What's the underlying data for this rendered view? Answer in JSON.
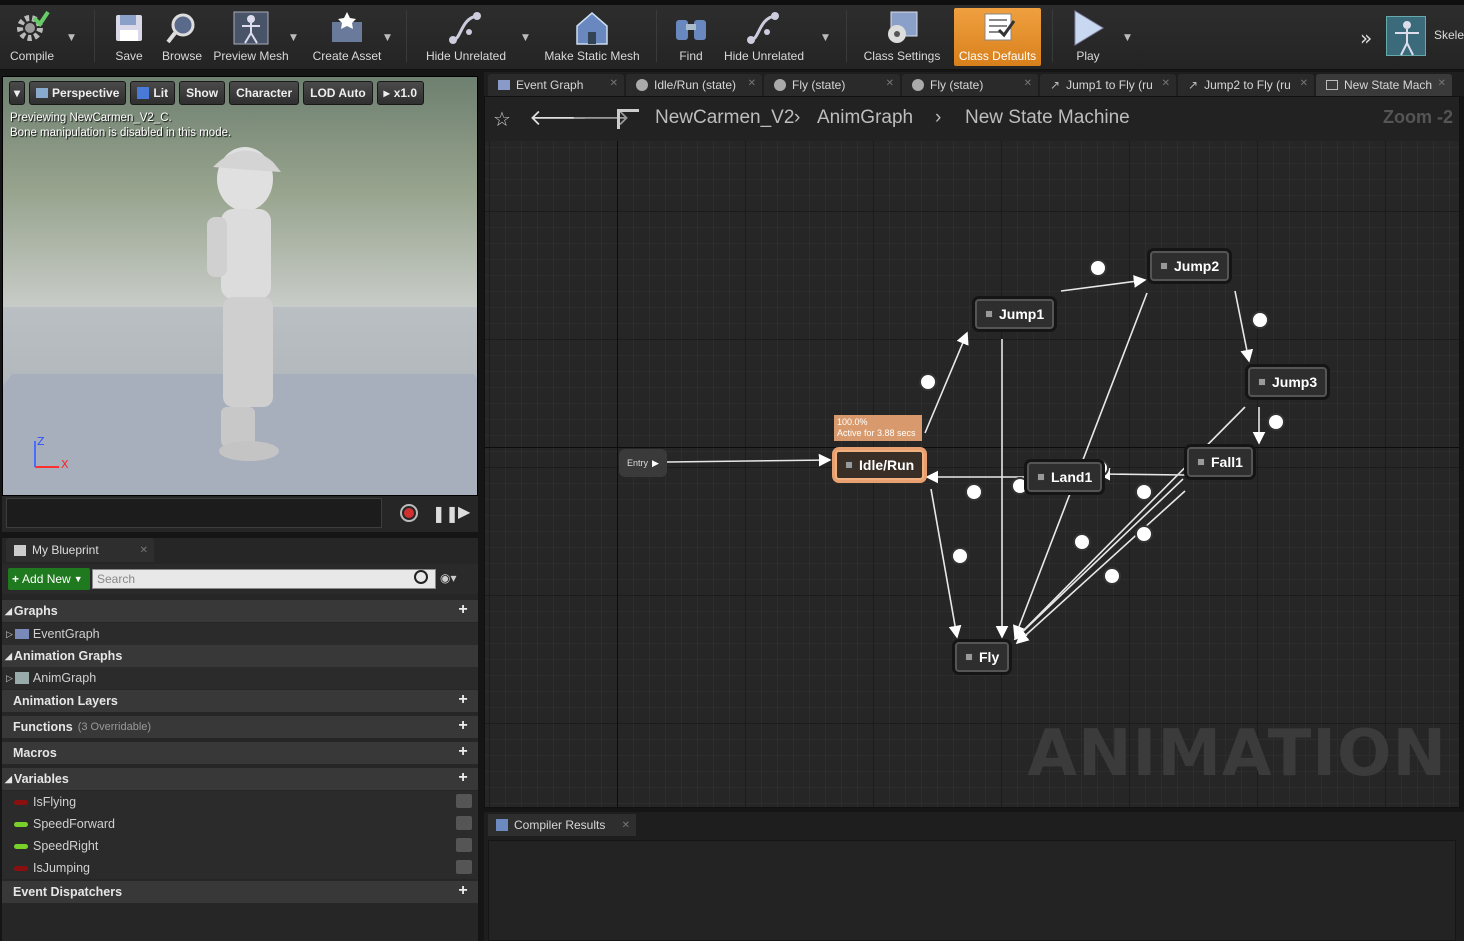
{
  "toolbar": {
    "compile": "Compile",
    "save": "Save",
    "browse": "Browse",
    "preview_mesh": "Preview Mesh",
    "create_asset": "Create Asset",
    "hide_unrelated_1": "Hide Unrelated",
    "make_static_mesh": "Make Static Mesh",
    "find": "Find",
    "hide_unrelated_2": "Hide Unrelated",
    "class_settings": "Class Settings",
    "class_defaults": "Class Defaults",
    "play": "Play",
    "skeleton": "Skelet"
  },
  "viewport": {
    "perspective": "Perspective",
    "lit": "Lit",
    "show": "Show",
    "character": "Character",
    "lod": "LOD Auto",
    "speed": "x1.0",
    "info_line1": "Previewing NewCarmen_V2_C.",
    "info_line2": "Bone manipulation is disabled in this mode.",
    "axis_z": "Z",
    "axis_x": "X"
  },
  "blueprint": {
    "tab": "My Blueprint",
    "add_new": "Add New",
    "search_placeholder": "Search",
    "graphs": "Graphs",
    "event_graph": "EventGraph",
    "animation_graphs": "Animation Graphs",
    "anim_graph": "AnimGraph",
    "animation_layers": "Animation Layers",
    "functions": "Functions",
    "functions_note": "(3 Overridable)",
    "macros": "Macros",
    "variables": "Variables",
    "vars": [
      {
        "name": "IsFlying",
        "color": "#8a1010"
      },
      {
        "name": "SpeedForward",
        "color": "#7ad02a"
      },
      {
        "name": "SpeedRight",
        "color": "#7ad02a"
      },
      {
        "name": "IsJumping",
        "color": "#8a1010"
      }
    ],
    "event_dispatchers": "Event Dispatchers"
  },
  "tabs": [
    {
      "label": "Event Graph"
    },
    {
      "label": "Idle/Run (state)"
    },
    {
      "label": "Fly (state)"
    },
    {
      "label": "Fly (state)"
    },
    {
      "label": "Jump1 to Fly (ru"
    },
    {
      "label": "Jump2 to Fly (ru"
    },
    {
      "label": "New State Mach"
    }
  ],
  "graph": {
    "crumb_1": "NewCarmen_V2",
    "crumb_2": "AnimGraph",
    "crumb_3": "New State Machine",
    "zoom": "Zoom -2",
    "watermark": "ANIMATION",
    "entry": "Entry",
    "badge_pct": "100.0%",
    "badge_time": "Active for 3.88 secs",
    "nodes": {
      "idle_run": "Idle/Run",
      "jump1": "Jump1",
      "jump2": "Jump2",
      "jump3": "Jump3",
      "fall1": "Fall1",
      "land1": "Land1",
      "fly": "Fly"
    }
  },
  "compiler": {
    "tab": "Compiler Results"
  }
}
